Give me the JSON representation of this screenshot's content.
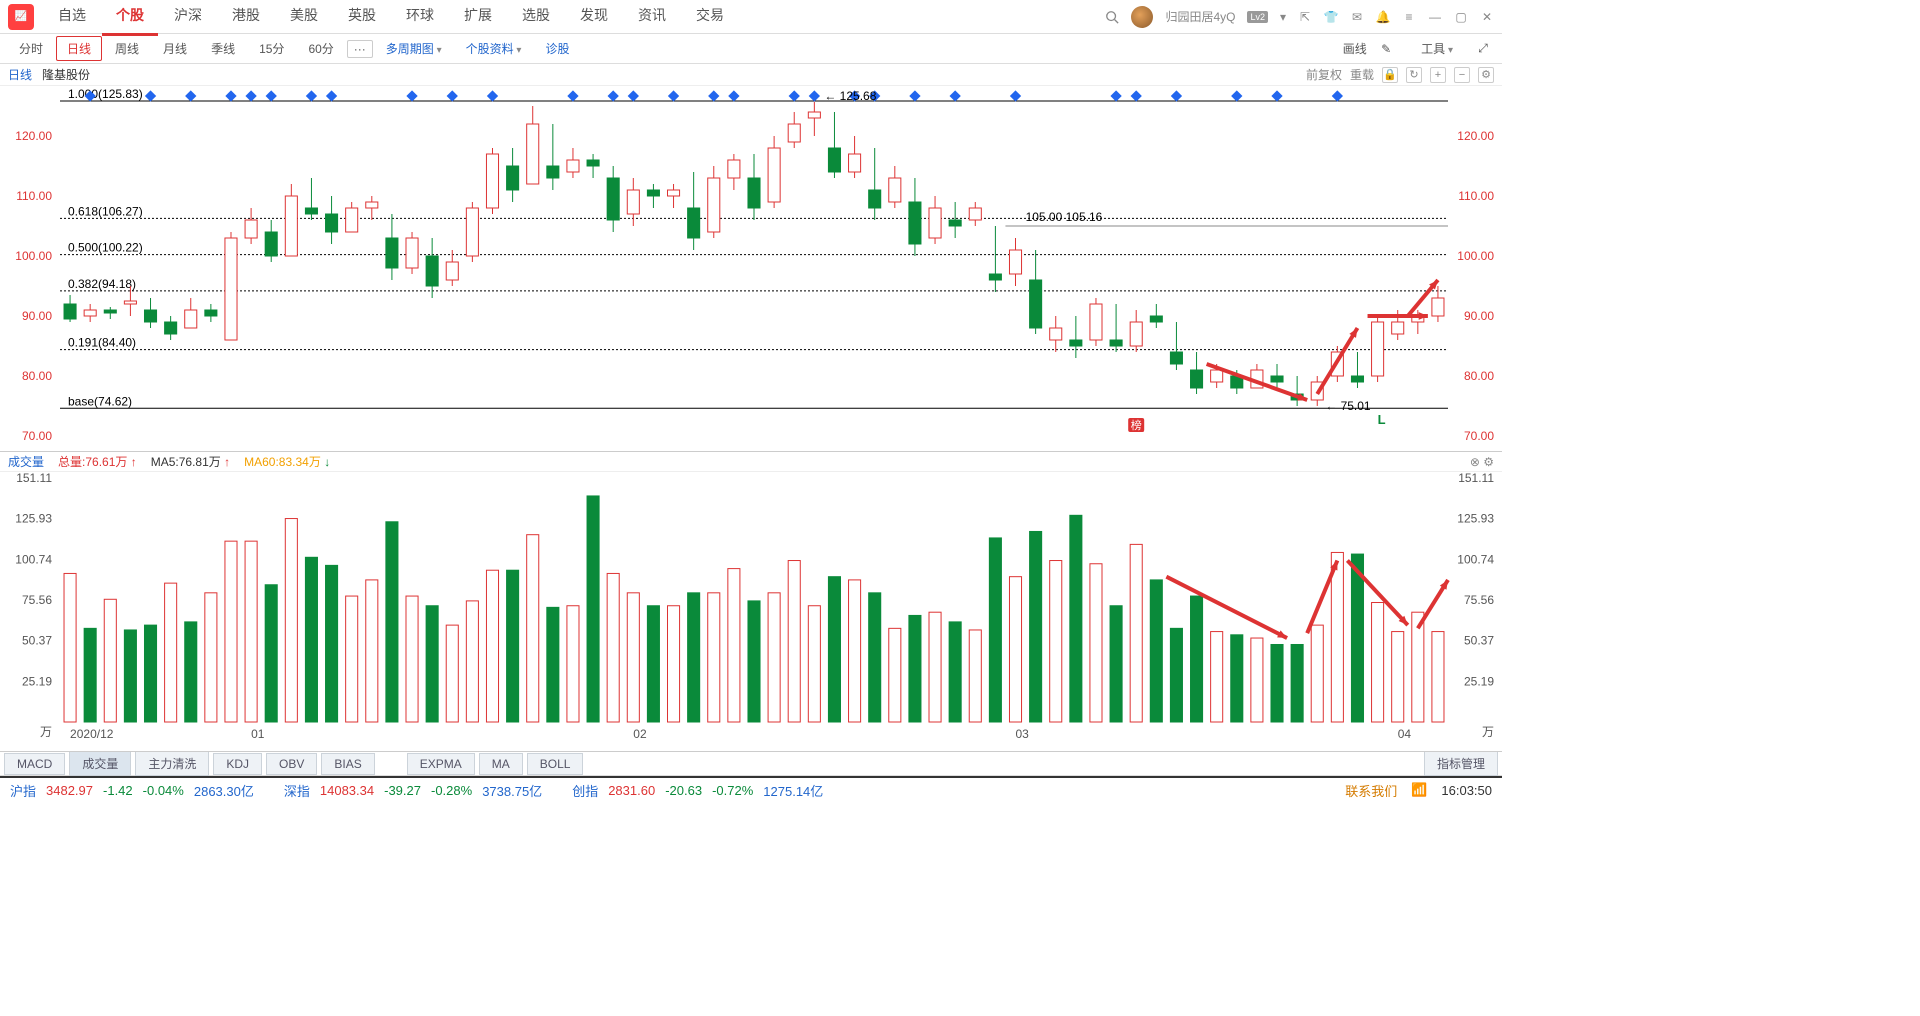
{
  "top_menu": {
    "tabs": [
      "自选",
      "个股",
      "沪深",
      "港股",
      "美股",
      "英股",
      "环球",
      "扩展",
      "选股",
      "发现",
      "资讯",
      "交易"
    ],
    "active_index": 1,
    "user": "归园田居4yQ",
    "lv2": "Lv2"
  },
  "sub_toolbar": {
    "periods": [
      "分时",
      "日线",
      "周线",
      "月线",
      "季线",
      "15分",
      "60分"
    ],
    "active_period_index": 1,
    "more": "···",
    "multi_period": "多周期图",
    "stock_info": "个股资料",
    "diagnose": "诊股",
    "draw": "画线",
    "tools": "工具"
  },
  "chart_head": {
    "kline": "日线",
    "stock": "隆基股份",
    "reinstate": "前复权",
    "reload": "重载"
  },
  "fib": {
    "l1000": "1.000(125.83)",
    "l618": "0.618(106.27)",
    "l500": "0.500(100.22)",
    "l382": "0.382(94.18)",
    "l191": "0.191(84.40)",
    "base": "base(74.62)"
  },
  "price_annotations": {
    "high": "125.68",
    "mid": "105.00  105.16",
    "low": "75.01"
  },
  "badge_rank": "榜",
  "l_mark": "L",
  "vol_head": {
    "label": "成交量",
    "total": "总量:76.61万",
    "ma5": "MA5:76.81万",
    "ma60": "MA60:83.34万"
  },
  "indicator_tabs": {
    "tabs": [
      "MACD",
      "成交量",
      "主力清洗",
      "KDJ",
      "OBV",
      "BIAS",
      "",
      "EXPMA",
      "MA",
      "BOLL"
    ],
    "active_index": 1,
    "manage": "指标管理"
  },
  "status": {
    "idx1_label": "沪指",
    "idx1_val": "3482.97",
    "idx1_chg": "-1.42",
    "idx1_pct": "-0.04%",
    "idx1_amt": "2863.30亿",
    "idx2_label": "深指",
    "idx2_val": "14083.34",
    "idx2_chg": "-39.27",
    "idx2_pct": "-0.28%",
    "idx2_amt": "3738.75亿",
    "idx3_label": "创指",
    "idx3_val": "2831.60",
    "idx3_chg": "-20.63",
    "idx3_pct": "-0.72%",
    "idx3_amt": "1275.14亿",
    "contact": "联系我们",
    "time": "16:03:50"
  },
  "chart_data": {
    "type": "candlestick+volume",
    "title": "隆基股份 日线",
    "price": {
      "ylim": [
        70,
        127
      ],
      "yticks": [
        70,
        80,
        90,
        100,
        110,
        120
      ],
      "fib_levels": [
        125.83,
        106.27,
        100.22,
        94.18,
        84.4,
        74.62
      ],
      "high_annot": 125.68,
      "mid_annot": [
        105.0,
        105.16
      ],
      "low_annot": 75.01,
      "candles": [
        {
          "o": 92,
          "h": 93.5,
          "l": 89,
          "c": 89.5,
          "up": false
        },
        {
          "o": 90,
          "h": 92,
          "l": 89,
          "c": 91,
          "up": true
        },
        {
          "o": 91,
          "h": 91.5,
          "l": 89.5,
          "c": 90.5,
          "up": false
        },
        {
          "o": 92,
          "h": 95,
          "l": 90,
          "c": 92.5,
          "up": true
        },
        {
          "o": 91,
          "h": 93,
          "l": 88,
          "c": 89,
          "up": false
        },
        {
          "o": 89,
          "h": 90,
          "l": 86,
          "c": 87,
          "up": false
        },
        {
          "o": 88,
          "h": 93,
          "l": 88,
          "c": 91,
          "up": true
        },
        {
          "o": 91,
          "h": 92,
          "l": 89,
          "c": 90,
          "up": false
        },
        {
          "o": 86,
          "h": 104,
          "l": 86,
          "c": 103,
          "up": true
        },
        {
          "o": 103,
          "h": 108,
          "l": 102,
          "c": 106,
          "up": true
        },
        {
          "o": 104,
          "h": 106,
          "l": 99,
          "c": 100,
          "up": false
        },
        {
          "o": 100,
          "h": 112,
          "l": 100,
          "c": 110,
          "up": true
        },
        {
          "o": 108,
          "h": 113,
          "l": 106,
          "c": 107,
          "up": false
        },
        {
          "o": 107,
          "h": 110,
          "l": 102,
          "c": 104,
          "up": false
        },
        {
          "o": 104,
          "h": 109,
          "l": 104,
          "c": 108,
          "up": true
        },
        {
          "o": 108,
          "h": 110,
          "l": 106,
          "c": 109,
          "up": true
        },
        {
          "o": 103,
          "h": 107,
          "l": 96,
          "c": 98,
          "up": false
        },
        {
          "o": 98,
          "h": 104,
          "l": 97,
          "c": 103,
          "up": true
        },
        {
          "o": 100,
          "h": 103,
          "l": 93,
          "c": 95,
          "up": false
        },
        {
          "o": 96,
          "h": 101,
          "l": 95,
          "c": 99,
          "up": true
        },
        {
          "o": 100,
          "h": 109,
          "l": 99,
          "c": 108,
          "up": true
        },
        {
          "o": 108,
          "h": 118,
          "l": 107,
          "c": 117,
          "up": true
        },
        {
          "o": 115,
          "h": 118,
          "l": 109,
          "c": 111,
          "up": false
        },
        {
          "o": 112,
          "h": 125,
          "l": 112,
          "c": 122,
          "up": true
        },
        {
          "o": 115,
          "h": 122,
          "l": 111,
          "c": 113,
          "up": false
        },
        {
          "o": 114,
          "h": 118,
          "l": 113,
          "c": 116,
          "up": true
        },
        {
          "o": 116,
          "h": 117,
          "l": 113,
          "c": 115,
          "up": false
        },
        {
          "o": 113,
          "h": 115,
          "l": 104,
          "c": 106,
          "up": false
        },
        {
          "o": 107,
          "h": 113,
          "l": 105,
          "c": 111,
          "up": true
        },
        {
          "o": 111,
          "h": 112,
          "l": 108,
          "c": 110,
          "up": false
        },
        {
          "o": 110,
          "h": 112,
          "l": 108,
          "c": 111,
          "up": true
        },
        {
          "o": 108,
          "h": 114,
          "l": 101,
          "c": 103,
          "up": false
        },
        {
          "o": 104,
          "h": 115,
          "l": 103,
          "c": 113,
          "up": true
        },
        {
          "o": 113,
          "h": 117,
          "l": 111,
          "c": 116,
          "up": true
        },
        {
          "o": 113,
          "h": 117,
          "l": 106,
          "c": 108,
          "up": false
        },
        {
          "o": 109,
          "h": 120,
          "l": 108,
          "c": 118,
          "up": true
        },
        {
          "o": 119,
          "h": 124,
          "l": 118,
          "c": 122,
          "up": true
        },
        {
          "o": 123,
          "h": 125.68,
          "l": 120,
          "c": 124,
          "up": true
        },
        {
          "o": 118,
          "h": 124,
          "l": 113,
          "c": 114,
          "up": false
        },
        {
          "o": 114,
          "h": 120,
          "l": 113,
          "c": 117,
          "up": true
        },
        {
          "o": 111,
          "h": 118,
          "l": 106,
          "c": 108,
          "up": false
        },
        {
          "o": 109,
          "h": 115,
          "l": 108,
          "c": 113,
          "up": true
        },
        {
          "o": 109,
          "h": 113,
          "l": 100,
          "c": 102,
          "up": false
        },
        {
          "o": 103,
          "h": 110,
          "l": 102,
          "c": 108,
          "up": true
        },
        {
          "o": 106,
          "h": 109,
          "l": 103,
          "c": 105,
          "up": false
        },
        {
          "o": 106,
          "h": 109,
          "l": 105,
          "c": 108,
          "up": true
        },
        {
          "o": 97,
          "h": 105,
          "l": 94,
          "c": 96,
          "up": false
        },
        {
          "o": 97,
          "h": 103,
          "l": 95,
          "c": 101,
          "up": true
        },
        {
          "o": 96,
          "h": 101,
          "l": 87,
          "c": 88,
          "up": false
        },
        {
          "o": 86,
          "h": 90,
          "l": 84,
          "c": 88,
          "up": true
        },
        {
          "o": 86,
          "h": 90,
          "l": 83,
          "c": 85,
          "up": false
        },
        {
          "o": 86,
          "h": 93,
          "l": 85,
          "c": 92,
          "up": true
        },
        {
          "o": 86,
          "h": 92,
          "l": 84,
          "c": 85,
          "up": false
        },
        {
          "o": 85,
          "h": 91,
          "l": 84,
          "c": 89,
          "up": true
        },
        {
          "o": 89,
          "h": 92,
          "l": 88,
          "c": 90,
          "up": false
        },
        {
          "o": 84,
          "h": 89,
          "l": 81,
          "c": 82,
          "up": false
        },
        {
          "o": 81,
          "h": 84,
          "l": 77,
          "c": 78,
          "up": false
        },
        {
          "o": 79,
          "h": 82,
          "l": 78,
          "c": 81,
          "up": true
        },
        {
          "o": 80,
          "h": 81,
          "l": 77,
          "c": 78,
          "up": false
        },
        {
          "o": 78,
          "h": 82,
          "l": 78,
          "c": 81,
          "up": true
        },
        {
          "o": 79,
          "h": 82,
          "l": 78,
          "c": 80,
          "up": false
        },
        {
          "o": 77,
          "h": 80,
          "l": 75,
          "c": 76,
          "up": false
        },
        {
          "o": 76,
          "h": 80,
          "l": 75.01,
          "c": 79,
          "up": true
        },
        {
          "o": 80,
          "h": 85,
          "l": 79,
          "c": 84,
          "up": true
        },
        {
          "o": 80,
          "h": 84,
          "l": 78,
          "c": 79,
          "up": false
        },
        {
          "o": 80,
          "h": 90,
          "l": 79,
          "c": 89,
          "up": true
        },
        {
          "o": 87,
          "h": 91,
          "l": 86,
          "c": 89,
          "up": true
        },
        {
          "o": 89,
          "h": 91,
          "l": 87,
          "c": 90,
          "up": true
        },
        {
          "o": 90,
          "h": 95,
          "l": 89,
          "c": 93,
          "up": true
        }
      ]
    },
    "volume": {
      "ylim": [
        0,
        151.11
      ],
      "yticks": [
        25.19,
        50.37,
        75.56,
        100.74,
        125.93,
        151.11
      ],
      "unit": "万",
      "bars": [
        {
          "v": 92,
          "up": true
        },
        {
          "v": 58,
          "up": false
        },
        {
          "v": 76,
          "up": true
        },
        {
          "v": 57,
          "up": false
        },
        {
          "v": 60,
          "up": false
        },
        {
          "v": 86,
          "up": true
        },
        {
          "v": 62,
          "up": false
        },
        {
          "v": 80,
          "up": true
        },
        {
          "v": 112,
          "up": true
        },
        {
          "v": 112,
          "up": true
        },
        {
          "v": 85,
          "up": false
        },
        {
          "v": 126,
          "up": true
        },
        {
          "v": 102,
          "up": false
        },
        {
          "v": 97,
          "up": false
        },
        {
          "v": 78,
          "up": true
        },
        {
          "v": 88,
          "up": true
        },
        {
          "v": 124,
          "up": false
        },
        {
          "v": 78,
          "up": true
        },
        {
          "v": 72,
          "up": false
        },
        {
          "v": 60,
          "up": true
        },
        {
          "v": 75,
          "up": true
        },
        {
          "v": 94,
          "up": true
        },
        {
          "v": 94,
          "up": false
        },
        {
          "v": 116,
          "up": true
        },
        {
          "v": 71,
          "up": false
        },
        {
          "v": 72,
          "up": true
        },
        {
          "v": 140,
          "up": false
        },
        {
          "v": 92,
          "up": true
        },
        {
          "v": 80,
          "up": true
        },
        {
          "v": 72,
          "up": false
        },
        {
          "v": 72,
          "up": true
        },
        {
          "v": 80,
          "up": false
        },
        {
          "v": 80,
          "up": true
        },
        {
          "v": 95,
          "up": true
        },
        {
          "v": 75,
          "up": false
        },
        {
          "v": 80,
          "up": true
        },
        {
          "v": 100,
          "up": true
        },
        {
          "v": 72,
          "up": true
        },
        {
          "v": 90,
          "up": false
        },
        {
          "v": 88,
          "up": true
        },
        {
          "v": 80,
          "up": false
        },
        {
          "v": 58,
          "up": true
        },
        {
          "v": 66,
          "up": false
        },
        {
          "v": 68,
          "up": true
        },
        {
          "v": 62,
          "up": false
        },
        {
          "v": 57,
          "up": true
        },
        {
          "v": 114,
          "up": false
        },
        {
          "v": 90,
          "up": true
        },
        {
          "v": 118,
          "up": false
        },
        {
          "v": 100,
          "up": true
        },
        {
          "v": 128,
          "up": false
        },
        {
          "v": 98,
          "up": true
        },
        {
          "v": 72,
          "up": false
        },
        {
          "v": 110,
          "up": true
        },
        {
          "v": 88,
          "up": false
        },
        {
          "v": 58,
          "up": false
        },
        {
          "v": 78,
          "up": false
        },
        {
          "v": 56,
          "up": true
        },
        {
          "v": 54,
          "up": false
        },
        {
          "v": 52,
          "up": true
        },
        {
          "v": 48,
          "up": false
        },
        {
          "v": 48,
          "up": false
        },
        {
          "v": 60,
          "up": true
        },
        {
          "v": 105,
          "up": true
        },
        {
          "v": 104,
          "up": false
        },
        {
          "v": 74,
          "up": true
        },
        {
          "v": 56,
          "up": true
        },
        {
          "v": 68,
          "up": true
        },
        {
          "v": 56,
          "up": true
        }
      ],
      "date_ticks": [
        {
          "x": 0,
          "label": "2020/12"
        },
        {
          "x": 9,
          "label": "01"
        },
        {
          "x": 28,
          "label": "02"
        },
        {
          "x": 47,
          "label": "03"
        },
        {
          "x": 66,
          "label": "04"
        }
      ]
    }
  }
}
